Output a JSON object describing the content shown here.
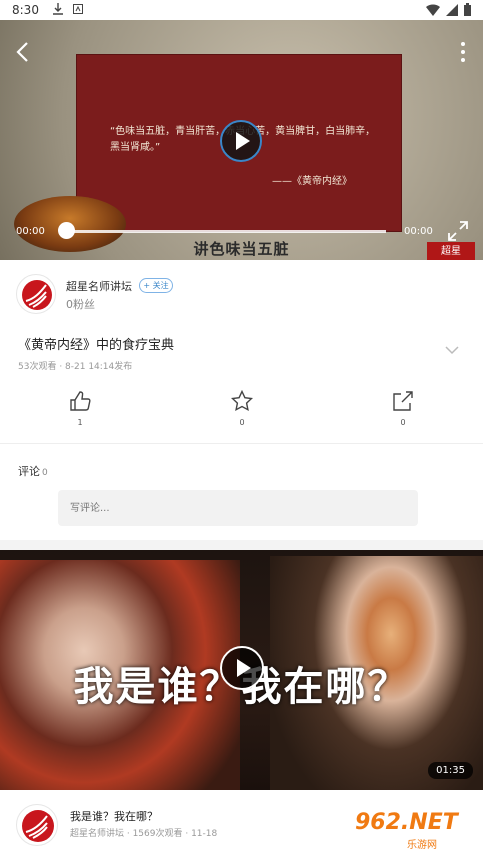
{
  "status_bar": {
    "time": "8:30"
  },
  "player": {
    "quote": "“色味当五脏，青当肝苦，赤当心苦，黄当脾甘，白当肺辛，黑当肾咸。”",
    "quote_source": "——《黄帝内经》",
    "subtitle": "讲色味当五脏",
    "current_time": "00:00",
    "total_time": "00:00",
    "progress": 0,
    "stamp_text": "超星"
  },
  "author": {
    "name": "超星名师讲坛",
    "follow_label": "+ 关注",
    "fans": "0粉丝"
  },
  "video": {
    "title": "《黄帝内经》中的食疗宝典",
    "meta": "53次观看 · 8-21 14:14发布"
  },
  "actions": {
    "like_count": "1",
    "favorite_count": "0",
    "share_count": "0"
  },
  "comments": {
    "label": "评论",
    "count": "0",
    "placeholder": "写评论..."
  },
  "related": {
    "headline": "我是谁？我在哪？",
    "duration": "01:35",
    "title": "我是谁？我在哪？",
    "meta": "超星名师讲坛 · 1569次观看 · 11-18"
  },
  "watermark": {
    "main": "962.NET",
    "sub": "乐游网"
  },
  "colors": {
    "accent": "#3a86c8",
    "brand_red": "#c8161d",
    "watermark_orange": "#f07a12"
  }
}
